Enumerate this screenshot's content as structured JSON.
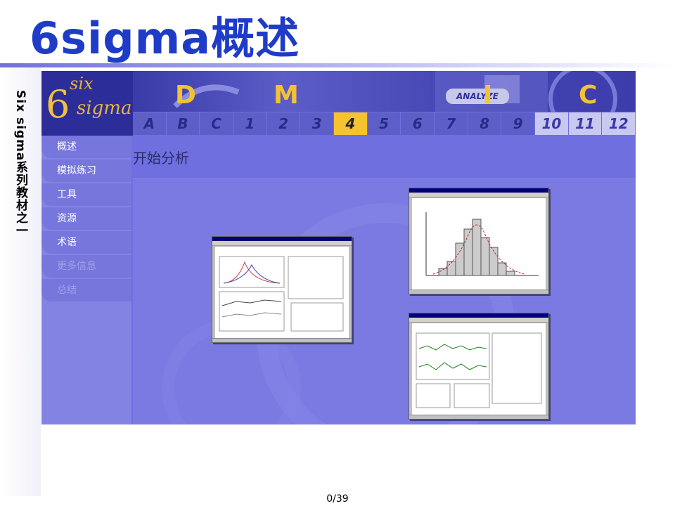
{
  "slide": {
    "title": "6sigma概述",
    "side_caption": "Six sigma系列教材之一",
    "page_number": "0/39"
  },
  "app": {
    "logo": {
      "six": "six",
      "sigma": "sigma",
      "numeral": "6"
    },
    "phases": [
      "D",
      "M",
      "I",
      "C"
    ],
    "analyze_label": "ANALYZE",
    "tabs": [
      "A",
      "B",
      "C",
      "1",
      "2",
      "3",
      "4",
      "5",
      "6",
      "7",
      "8",
      "9",
      "10",
      "11",
      "12"
    ],
    "active_tab": "4",
    "sidebar": [
      {
        "label": "概述",
        "muted": false
      },
      {
        "label": "模拟练习",
        "muted": false
      },
      {
        "label": "工具",
        "muted": false
      },
      {
        "label": "资源",
        "muted": false
      },
      {
        "label": "术语",
        "muted": false
      },
      {
        "label": "更多信息",
        "muted": true
      },
      {
        "label": "总结",
        "muted": true
      }
    ],
    "content_heading": "开始分析"
  },
  "colors": {
    "title": "#1f3cc8",
    "app_bg": "#6f6fe0",
    "accent_gold": "#f5c230",
    "banner": "#3a3aa8"
  }
}
